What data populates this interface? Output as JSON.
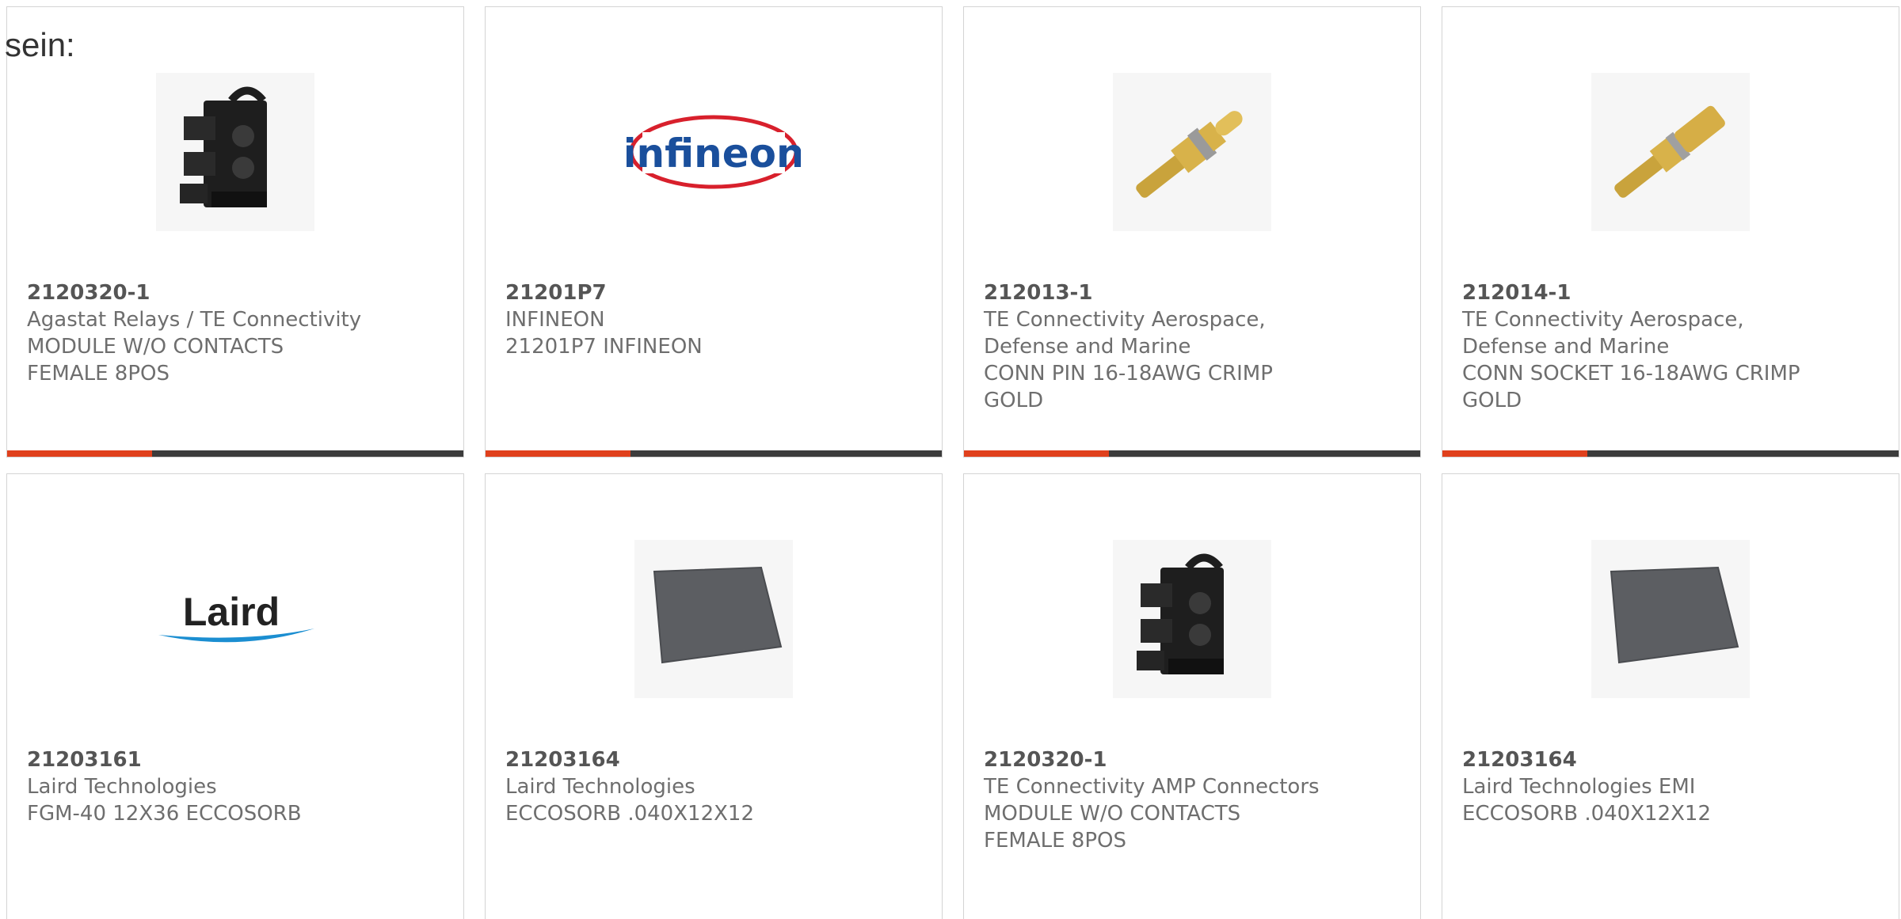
{
  "intro_text": "sein:",
  "colors": {
    "accent": "#e0401c",
    "bar": "#3c3c3c",
    "text": "#6e6e6e",
    "border": "#d4d4d4"
  },
  "products": [
    {
      "part_number": "2120320-1",
      "lines": [
        "Agastat Relays / TE Connectivity",
        "MODULE W/O CONTACTS",
        "FEMALE 8POS"
      ],
      "image": "black-connector-module-image"
    },
    {
      "part_number": "21201P7",
      "lines": [
        "INFINEON",
        "21201P7 INFINEON"
      ],
      "image": "infineon-logo",
      "logo_text": "infineon"
    },
    {
      "part_number": "212013-1",
      "lines": [
        "TE Connectivity Aerospace,",
        "Defense and Marine",
        "CONN PIN 16-18AWG CRIMP",
        "GOLD"
      ],
      "image": "gold-pin-contact-image"
    },
    {
      "part_number": "212014-1",
      "lines": [
        "TE Connectivity Aerospace,",
        "Defense and Marine",
        "CONN SOCKET 16-18AWG CRIMP",
        "GOLD"
      ],
      "image": "gold-socket-contact-image"
    },
    {
      "part_number": "21203161",
      "lines": [
        "Laird Technologies",
        "FGM-40 12X36 ECCOSORB"
      ],
      "image": "laird-logo",
      "logo_text": "Laird"
    },
    {
      "part_number": "21203164",
      "lines": [
        "Laird Technologies",
        "ECCOSORB .040X12X12"
      ],
      "image": "gray-absorber-sheet-image"
    },
    {
      "part_number": "2120320-1",
      "lines": [
        "TE Connectivity AMP Connectors",
        "MODULE W/O CONTACTS",
        "FEMALE 8POS"
      ],
      "image": "black-connector-module-image"
    },
    {
      "part_number": "21203164",
      "lines": [
        "Laird Technologies EMI",
        "ECCOSORB .040X12X12"
      ],
      "image": "gray-absorber-sheet-image"
    }
  ]
}
